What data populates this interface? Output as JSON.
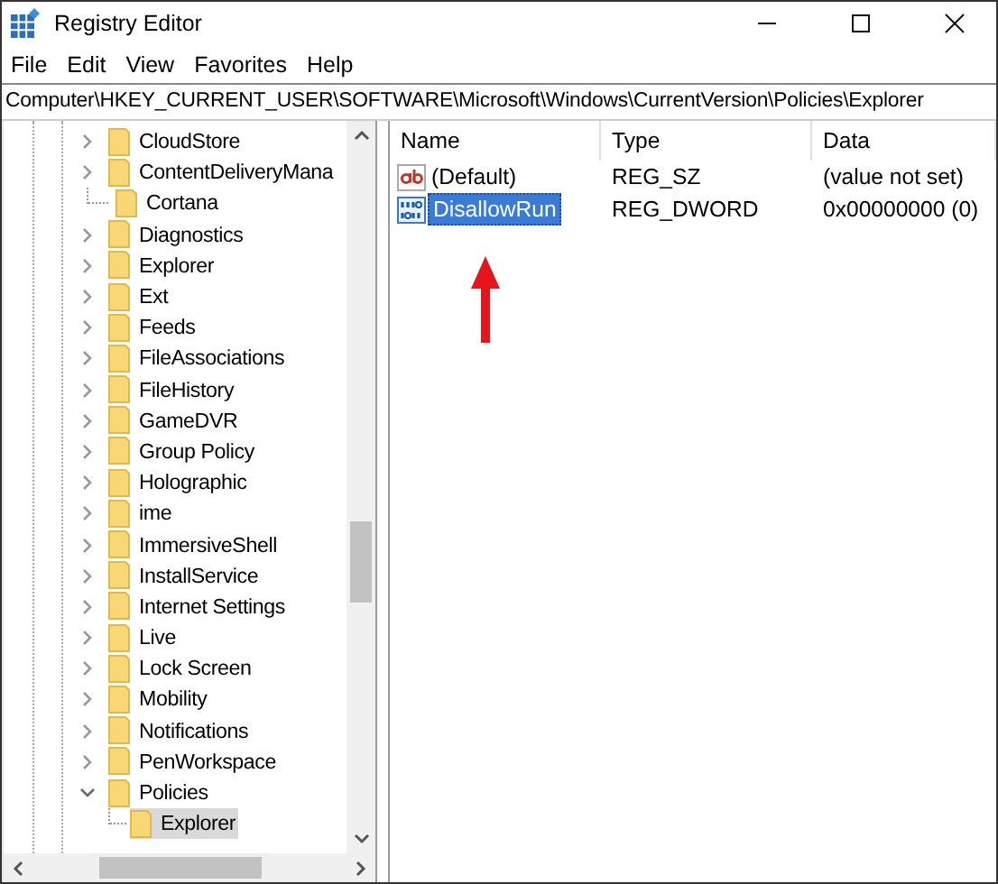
{
  "window": {
    "title": "Registry Editor"
  },
  "menu": [
    {
      "label": "File"
    },
    {
      "label": "Edit"
    },
    {
      "label": "View"
    },
    {
      "label": "Favorites"
    },
    {
      "label": "Help"
    }
  ],
  "address": "Computer\\HKEY_CURRENT_USER\\SOFTWARE\\Microsoft\\Windows\\CurrentVersion\\Policies\\Explorer",
  "tree": [
    {
      "label": "CloudStore",
      "expandable": true,
      "expanded": false,
      "selected": false
    },
    {
      "label": "ContentDeliveryMana",
      "expandable": true,
      "expanded": false,
      "selected": false
    },
    {
      "label": "Cortana",
      "expandable": false,
      "selected": false
    },
    {
      "label": "Diagnostics",
      "expandable": true,
      "expanded": false,
      "selected": false
    },
    {
      "label": "Explorer",
      "expandable": true,
      "expanded": false,
      "selected": false
    },
    {
      "label": "Ext",
      "expandable": true,
      "expanded": false,
      "selected": false
    },
    {
      "label": "Feeds",
      "expandable": true,
      "expanded": false,
      "selected": false
    },
    {
      "label": "FileAssociations",
      "expandable": true,
      "expanded": false,
      "selected": false
    },
    {
      "label": "FileHistory",
      "expandable": true,
      "expanded": false,
      "selected": false
    },
    {
      "label": "GameDVR",
      "expandable": true,
      "expanded": false,
      "selected": false
    },
    {
      "label": "Group Policy",
      "expandable": true,
      "expanded": false,
      "selected": false
    },
    {
      "label": "Holographic",
      "expandable": true,
      "expanded": false,
      "selected": false
    },
    {
      "label": "ime",
      "expandable": true,
      "expanded": false,
      "selected": false
    },
    {
      "label": "ImmersiveShell",
      "expandable": true,
      "expanded": false,
      "selected": false
    },
    {
      "label": "InstallService",
      "expandable": true,
      "expanded": false,
      "selected": false
    },
    {
      "label": "Internet Settings",
      "expandable": true,
      "expanded": false,
      "selected": false
    },
    {
      "label": "Live",
      "expandable": true,
      "expanded": false,
      "selected": false
    },
    {
      "label": "Lock Screen",
      "expandable": true,
      "expanded": false,
      "selected": false
    },
    {
      "label": "Mobility",
      "expandable": true,
      "expanded": false,
      "selected": false
    },
    {
      "label": "Notifications",
      "expandable": true,
      "expanded": false,
      "selected": false
    },
    {
      "label": "PenWorkspace",
      "expandable": true,
      "expanded": false,
      "selected": false
    },
    {
      "label": "Policies",
      "expandable": true,
      "expanded": true,
      "selected": false,
      "children": [
        {
          "label": "Explorer",
          "expandable": false,
          "selected": true
        }
      ]
    }
  ],
  "table": {
    "columns": [
      "Name",
      "Type",
      "Data"
    ],
    "rows": [
      {
        "kind": "string",
        "name": "(Default)",
        "type": "REG_SZ",
        "data": "(value not set)",
        "selected": false
      },
      {
        "kind": "binary",
        "name": "DisallowRun",
        "type": "REG_DWORD",
        "data": "0x00000000 (0)",
        "selected": true
      }
    ]
  }
}
